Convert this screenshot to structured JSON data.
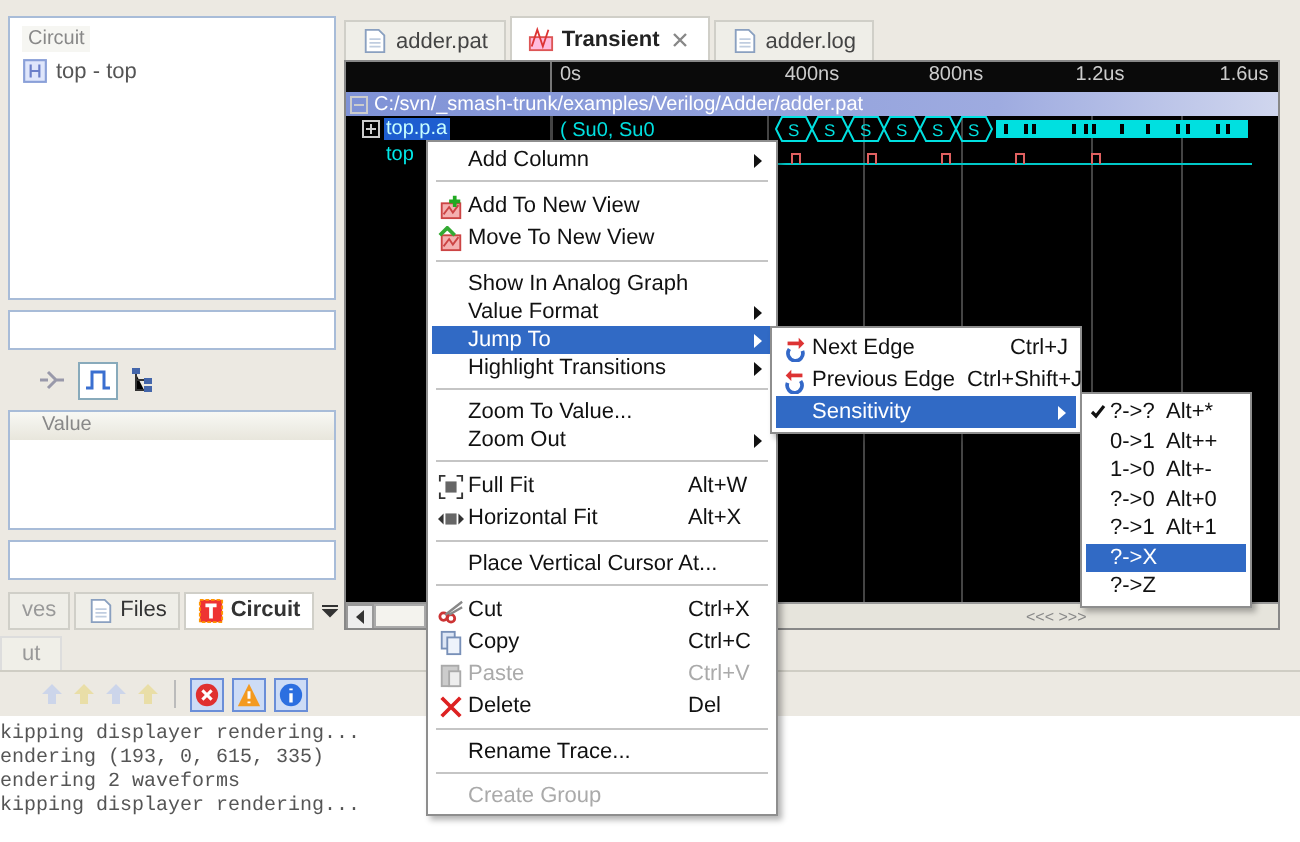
{
  "left_panel": {
    "tree_header": "Circuit",
    "tree": [
      {
        "label": "top - top"
      }
    ],
    "properties_header": "Value",
    "toolbar": [
      {
        "kind": "step",
        "selected": false
      },
      {
        "kind": "wave",
        "selected": true
      },
      {
        "kind": "hierarchy",
        "selected": false
      }
    ],
    "tabs": [
      {
        "label": "ves",
        "selected": false
      },
      {
        "label": "Files",
        "selected": false
      },
      {
        "label": "Circuit",
        "selected": true
      }
    ]
  },
  "editor_tabs": [
    {
      "label": "adder.pat",
      "selected": false,
      "closable": false
    },
    {
      "label": "Transient",
      "selected": true,
      "closable": true
    },
    {
      "label": "adder.log",
      "selected": false,
      "closable": false
    }
  ],
  "waveform": {
    "time_ticks": [
      "0s",
      "400ns",
      "800ns",
      "1.2us",
      "1.6us"
    ],
    "path": "C:/svn/_smash-trunk/examples/Verilog/Adder/adder.pat",
    "signals": [
      {
        "name": "top.p.a",
        "value": "( Su0, Su0",
        "selected": true,
        "kind": "bus",
        "expandable": true
      },
      {
        "name": "top",
        "selected": false,
        "kind": "bit",
        "expandable": false
      }
    ],
    "bus_labels": [
      "S",
      "S",
      "S",
      "S",
      "S",
      "S"
    ],
    "scroll_label": "<<< >>>"
  },
  "context_menu": {
    "items": [
      {
        "kind": "item",
        "label": "Add Column",
        "submenu": true,
        "selected": false,
        "disabled": false
      },
      {
        "kind": "separator"
      },
      {
        "kind": "item",
        "label": "Add To New View",
        "submenu": false,
        "selected": false,
        "disabled": false
      },
      {
        "kind": "item",
        "label": "Move To New View",
        "submenu": false,
        "selected": false,
        "disabled": false
      },
      {
        "kind": "separator"
      },
      {
        "kind": "item",
        "label": "Show In Analog Graph",
        "submenu": false,
        "selected": false,
        "disabled": false
      },
      {
        "kind": "item",
        "label": "Value Format",
        "submenu": true,
        "selected": false,
        "disabled": false
      },
      {
        "kind": "item",
        "label": "Jump To",
        "submenu": true,
        "selected": true,
        "disabled": false
      },
      {
        "kind": "item",
        "label": "Highlight Transitions",
        "submenu": true,
        "selected": false,
        "disabled": false
      },
      {
        "kind": "separator"
      },
      {
        "kind": "item",
        "label": "Zoom To Value...",
        "submenu": false,
        "selected": false,
        "disabled": false
      },
      {
        "kind": "item",
        "label": "Zoom Out",
        "submenu": true,
        "selected": false,
        "disabled": false
      },
      {
        "kind": "separator"
      },
      {
        "kind": "item",
        "label": "Full Fit",
        "shortcut": "Alt+W",
        "submenu": false,
        "selected": false,
        "disabled": false
      },
      {
        "kind": "item",
        "label": "Horizontal Fit",
        "shortcut": "Alt+X",
        "submenu": false,
        "selected": false,
        "disabled": false
      },
      {
        "kind": "separator"
      },
      {
        "kind": "item",
        "label": "Place Vertical Cursor At...",
        "submenu": false,
        "selected": false,
        "disabled": false
      },
      {
        "kind": "separator"
      },
      {
        "kind": "item",
        "label": "Cut",
        "shortcut": "Ctrl+X",
        "submenu": false,
        "selected": false,
        "disabled": false
      },
      {
        "kind": "item",
        "label": "Copy",
        "shortcut": "Ctrl+C",
        "submenu": false,
        "selected": false,
        "disabled": false
      },
      {
        "kind": "item",
        "label": "Paste",
        "shortcut": "Ctrl+V",
        "submenu": false,
        "selected": false,
        "disabled": true
      },
      {
        "kind": "item",
        "label": "Delete",
        "shortcut": "Del",
        "submenu": false,
        "selected": false,
        "disabled": false
      },
      {
        "kind": "separator"
      },
      {
        "kind": "item",
        "label": "Rename Trace...",
        "submenu": false,
        "selected": false,
        "disabled": false
      },
      {
        "kind": "separator"
      },
      {
        "kind": "item",
        "label": "Create Group",
        "submenu": false,
        "selected": false,
        "disabled": true
      }
    ]
  },
  "jump_submenu": {
    "items": [
      {
        "label": "Next Edge",
        "shortcut": "Ctrl+J",
        "submenu": false,
        "selected": false
      },
      {
        "label": "Previous Edge",
        "shortcut": "Ctrl+Shift+J",
        "submenu": false,
        "selected": false
      },
      {
        "label": "Sensitivity",
        "submenu": true,
        "selected": true
      }
    ]
  },
  "sensitivity_submenu": {
    "items": [
      {
        "label": "?->?",
        "shortcut": "Alt+*",
        "checked": true,
        "selected": false
      },
      {
        "label": "0->1",
        "shortcut": "Alt++",
        "checked": false,
        "selected": false
      },
      {
        "label": "1->0",
        "shortcut": "Alt+-",
        "checked": false,
        "selected": false
      },
      {
        "label": "?->0",
        "shortcut": "Alt+0",
        "checked": false,
        "selected": false
      },
      {
        "label": "?->1",
        "shortcut": "Alt+1",
        "checked": false,
        "selected": false
      },
      {
        "label": "?->X",
        "checked": false,
        "selected": true
      },
      {
        "label": "?->Z",
        "checked": false,
        "selected": false
      }
    ]
  },
  "console": {
    "tab": "ut",
    "lines": [
      "kipping displayer rendering...",
      "endering (193, 0, 615, 335)",
      "endering 2 waveforms",
      "kipping displayer rendering..."
    ]
  }
}
